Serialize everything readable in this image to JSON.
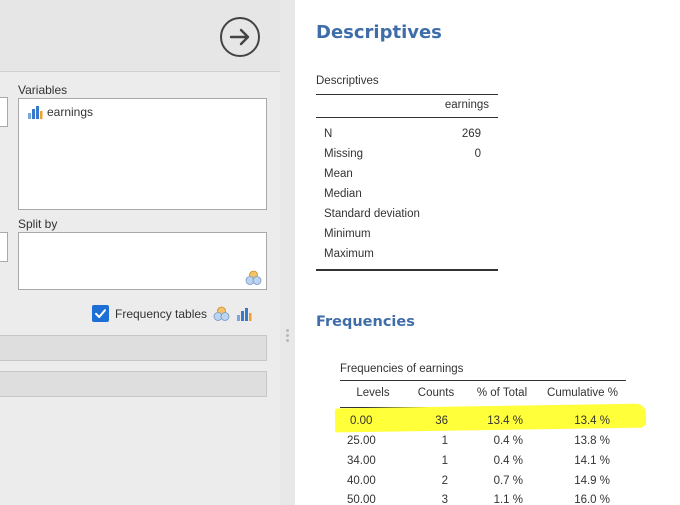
{
  "options": {
    "variables_label": "Variables",
    "variable_items": [
      {
        "name": "earnings",
        "icon": "continuous-variable-icon"
      }
    ],
    "split_by_label": "Split by",
    "frequency_tables": {
      "label": "Frequency tables",
      "checked": true
    }
  },
  "results": {
    "descriptives_heading": "Descriptives",
    "descriptives_table": {
      "caption": "Descriptives",
      "column": "earnings",
      "rows": [
        {
          "label": "N",
          "value": "269"
        },
        {
          "label": "Missing",
          "value": "0"
        },
        {
          "label": "Mean",
          "value": ""
        },
        {
          "label": "Median",
          "value": ""
        },
        {
          "label": "Standard deviation",
          "value": ""
        },
        {
          "label": "Minimum",
          "value": ""
        },
        {
          "label": "Maximum",
          "value": ""
        }
      ]
    },
    "frequencies_heading": "Frequencies",
    "frequencies_table": {
      "caption": "Frequencies of earnings",
      "headers": [
        "Levels",
        "Counts",
        "% of Total",
        "Cumulative %"
      ],
      "rows": [
        [
          "0.00",
          "36",
          "13.4 %",
          "13.4 %"
        ],
        [
          "25.00",
          "1",
          "0.4 %",
          "13.8 %"
        ],
        [
          "34.00",
          "1",
          "0.4 %",
          "14.1 %"
        ],
        [
          "40.00",
          "2",
          "0.7 %",
          "14.9 %"
        ],
        [
          "50.00",
          "3",
          "1.1 %",
          "16.0 %"
        ]
      ]
    }
  },
  "colors": {
    "heading": "#3e6da9",
    "accent": "#1d6fd6",
    "highlight": "#ffff3a"
  }
}
